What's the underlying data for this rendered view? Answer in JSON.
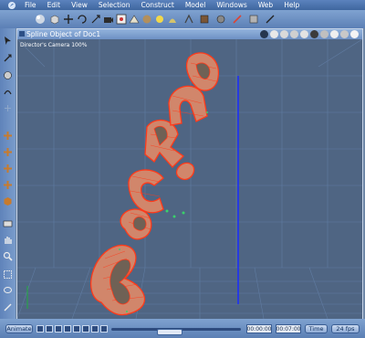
{
  "menu": {
    "items": [
      "File",
      "Edit",
      "View",
      "Selection",
      "Construct",
      "Model",
      "Windows",
      "Web",
      "Help"
    ]
  },
  "toolbar": {
    "tools": [
      "sphere-icon",
      "cube-icon",
      "move-icon",
      "rotate-icon",
      "scale-icon",
      "camera-icon",
      "render-icon",
      "light-icon",
      "material-icon",
      "render-settings-icon",
      "drape-icon",
      "paint-icon",
      "brush-icon",
      "wand-icon",
      "deform-icon",
      "stop-icon"
    ]
  },
  "left_tools": [
    "select-arrow-icon",
    "move-object-icon",
    "rotate-object-icon",
    "scale-object-icon",
    "twist-icon",
    "extrude-icon",
    "bend-icon",
    "plus-move-icon",
    "cross-move-icon",
    "vertex-icon",
    "faces-icon",
    "shading-icon",
    "camera-tool-icon",
    "hand-pan-icon",
    "zoom-icon",
    "rectangle-select-icon",
    "lasso-icon",
    "pen-icon"
  ],
  "viewport": {
    "title": "Spline Object of Doc1",
    "camera_label": "Director's Camera 100%",
    "view_icons": [
      "snap-icon",
      "shading-icon",
      "wire-icon",
      "points-icon",
      "camera-view-icon",
      "ground-icon",
      "box-icon",
      "render-preview-icon",
      "light-preview-icon",
      "render-view-icon"
    ],
    "object_text": "Rocking"
  },
  "timeline": {
    "animate_label": "Animate",
    "current_time": "00:00:00",
    "end_time": "00:07:00",
    "mode_label": "Time",
    "fps_label": "24 fps"
  },
  "colors": {
    "spline": "#ff3a1a",
    "surface": "#d1866b",
    "grid": "#5d7598",
    "axis_blue": "#1a2cff"
  }
}
